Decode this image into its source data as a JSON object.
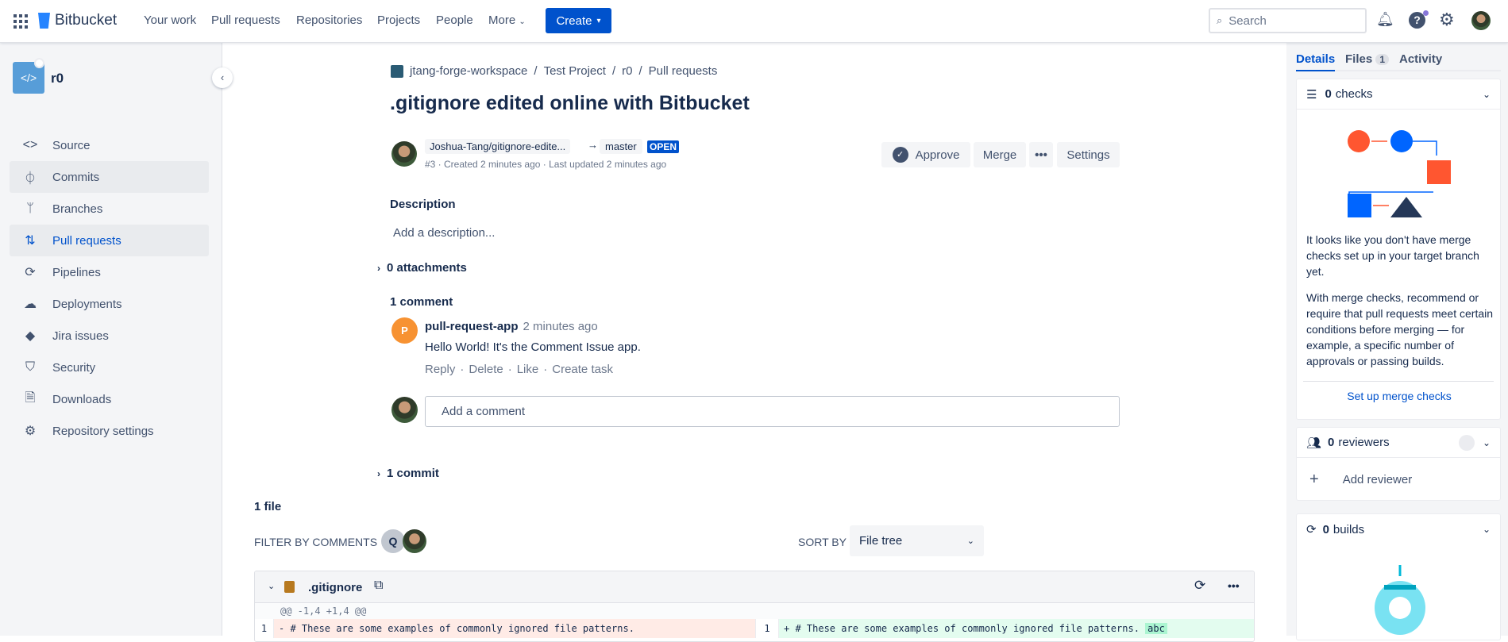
{
  "topbar": {
    "brand": "Bitbucket",
    "nav": [
      "Your work",
      "Pull requests",
      "Repositories",
      "Projects",
      "People",
      "More"
    ],
    "create": "Create",
    "search_placeholder": "Search"
  },
  "sidebar": {
    "repo": "r0",
    "items": [
      {
        "label": "Source",
        "icon": "code-icon"
      },
      {
        "label": "Commits",
        "icon": "commit-icon"
      },
      {
        "label": "Branches",
        "icon": "branch-icon"
      },
      {
        "label": "Pull requests",
        "icon": "pull-request-icon"
      },
      {
        "label": "Pipelines",
        "icon": "pipelines-icon"
      },
      {
        "label": "Deployments",
        "icon": "cloud-icon"
      },
      {
        "label": "Jira issues",
        "icon": "jira-icon"
      },
      {
        "label": "Security",
        "icon": "shield-icon"
      },
      {
        "label": "Downloads",
        "icon": "file-icon"
      },
      {
        "label": "Repository settings",
        "icon": "gear-icon"
      }
    ]
  },
  "breadcrumb": [
    "jtang-forge-workspace",
    "Test Project",
    "r0",
    "Pull requests"
  ],
  "pr": {
    "title": ".gitignore edited online with Bitbucket",
    "source_branch": "Joshua-Tang/gitignore-edite...",
    "target_branch": "master",
    "status": "OPEN",
    "meta": "#3 · Created 2 minutes ago · Last updated 2 minutes ago",
    "actions": {
      "approve": "Approve",
      "merge": "Merge",
      "settings": "Settings"
    }
  },
  "description": {
    "heading": "Description",
    "placeholder": "Add a description..."
  },
  "attachments": "0 attachments",
  "comments": {
    "heading": "1 comment",
    "items": [
      {
        "avatar_letter": "P",
        "author": "pull-request-app",
        "time": "2 minutes ago",
        "text": "Hello World! It's the Comment Issue app.",
        "actions": [
          "Reply",
          "Delete",
          "Like",
          "Create task"
        ]
      }
    ],
    "add_placeholder": "Add a comment"
  },
  "commits": "1 commit",
  "files": {
    "count": "1 file",
    "filter_label": "FILTER BY COMMENTS",
    "sort_label": "SORT BY",
    "sort_value": "File tree",
    "file": {
      "name": ".gitignore",
      "hunk": "@@ -1,4 +1,4 @@",
      "left": {
        "num": "1",
        "text": "- # These are some examples of commonly ignored file patterns."
      },
      "right": {
        "num": "1",
        "text": "+ # These are some examples of commonly ignored file patterns.",
        "added": "abc"
      }
    }
  },
  "panel": {
    "tabs": [
      "Details",
      "Files",
      "Activity"
    ],
    "files_badge": "1",
    "checks": {
      "count": "0",
      "label": "checks",
      "text1": "It looks like you don't have merge checks set up in your target branch yet.",
      "text2": "With merge checks, recommend or require that pull requests meet certain conditions before merging — for example, a specific number of approvals or passing builds.",
      "link": "Set up merge checks"
    },
    "reviewers": {
      "count": "0",
      "label": "reviewers",
      "add": "Add reviewer"
    },
    "builds": {
      "count": "0",
      "label": "builds"
    }
  },
  "colors": {
    "brand": "#0052cc",
    "removed": "#ffebe6",
    "added": "#e3fcef",
    "added_hl": "#abf5d1"
  }
}
